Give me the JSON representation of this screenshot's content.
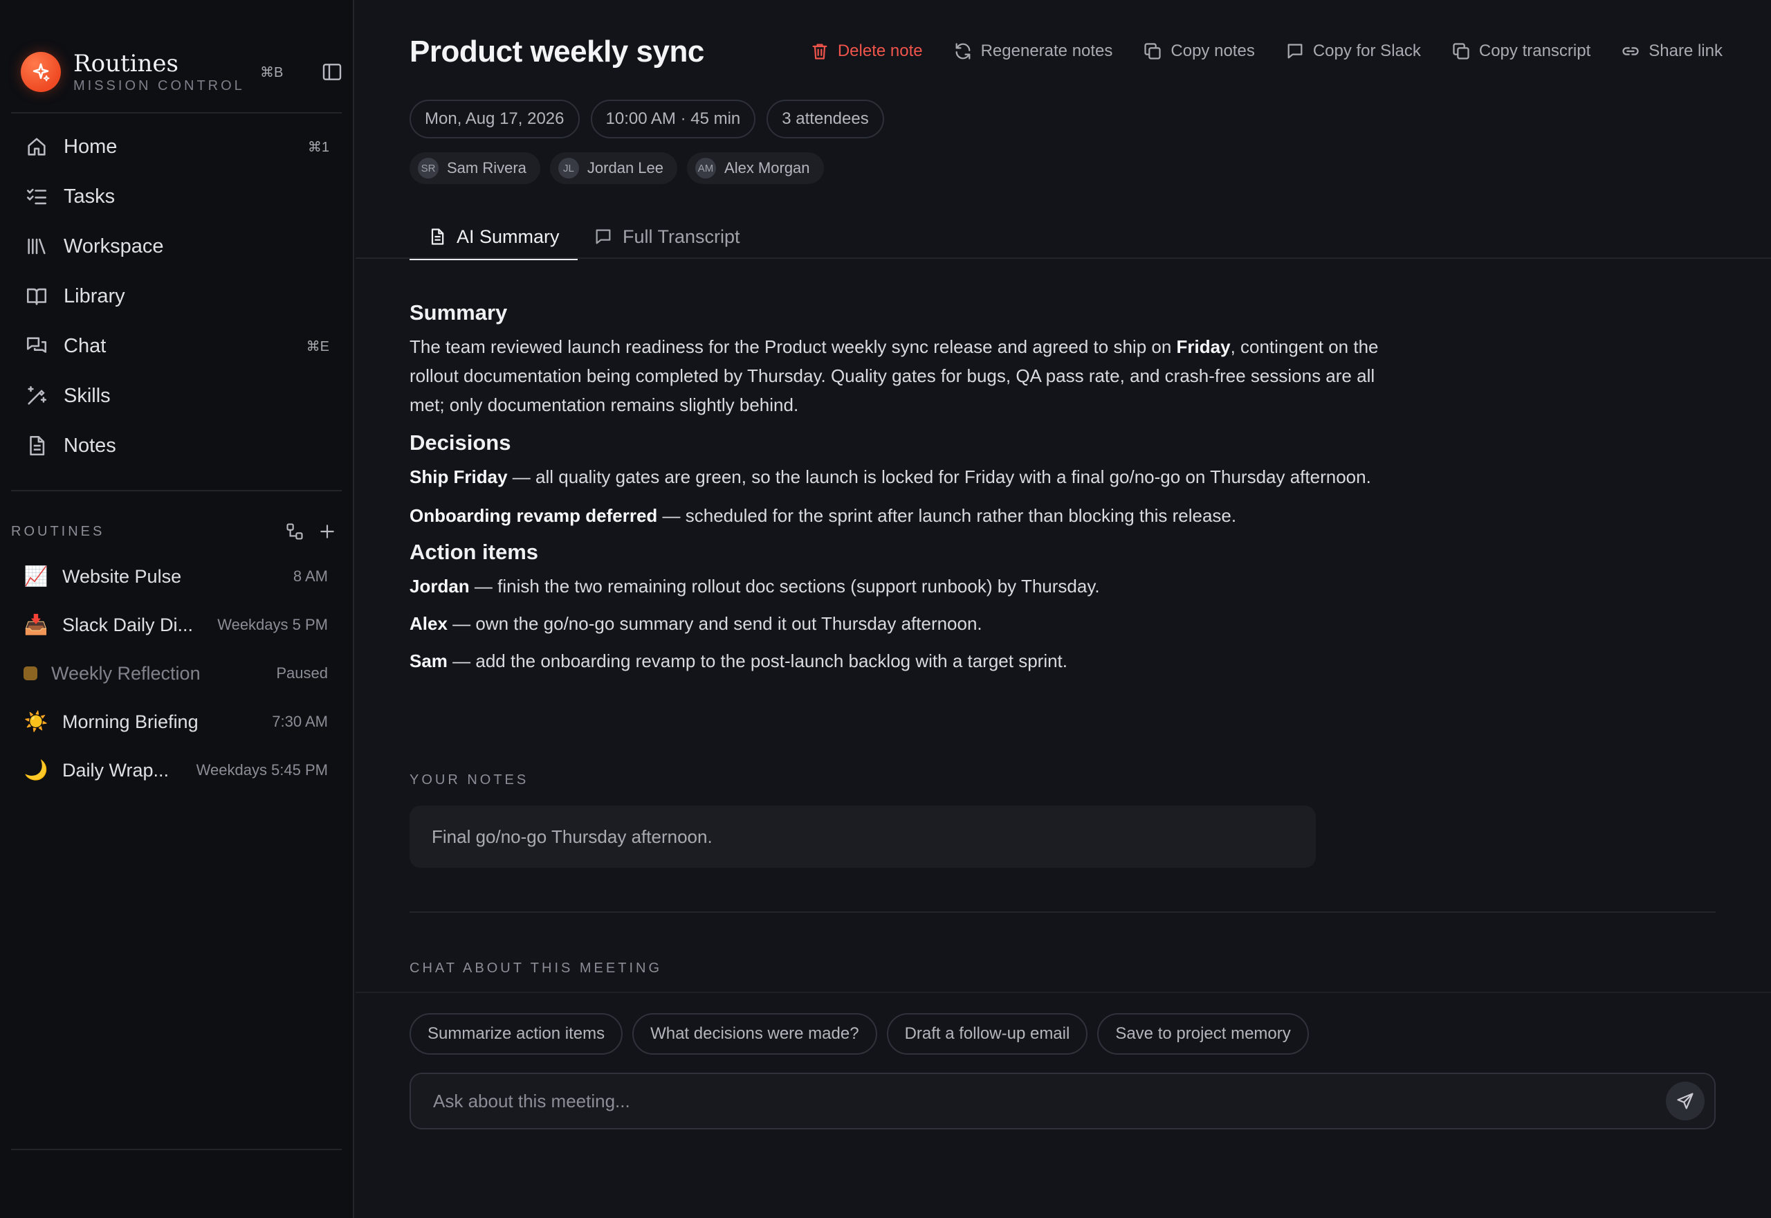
{
  "app": {
    "name": "Routines",
    "subtitle": "MISSION CONTROL",
    "toggle_shortcut": "⌘B"
  },
  "nav": [
    {
      "label": "Home",
      "icon": "home-icon",
      "shortcut": "⌘1"
    },
    {
      "label": "Tasks",
      "icon": "tasks-icon",
      "shortcut": ""
    },
    {
      "label": "Workspace",
      "icon": "workspace-icon",
      "shortcut": ""
    },
    {
      "label": "Library",
      "icon": "book-icon",
      "shortcut": ""
    },
    {
      "label": "Chat",
      "icon": "chat-icon",
      "shortcut": "⌘E"
    },
    {
      "label": "Skills",
      "icon": "wand-icon",
      "shortcut": ""
    },
    {
      "label": "Notes",
      "icon": "note-icon",
      "shortcut": ""
    }
  ],
  "routines": {
    "header": "ROUTINES",
    "items": [
      {
        "emoji": "📈",
        "name": "Website Pulse",
        "schedule": "8 AM",
        "paused": false
      },
      {
        "emoji": "📥",
        "name": "Slack Daily Di...",
        "schedule": "Weekdays 5 PM",
        "paused": false
      },
      {
        "emoji": "",
        "name": "Weekly Reflection",
        "schedule": "Paused",
        "paused": true
      },
      {
        "emoji": "☀️",
        "name": "Morning Briefing",
        "schedule": "7:30 AM",
        "paused": false
      },
      {
        "emoji": "🌙",
        "name": "Daily Wrap...",
        "schedule": "Weekdays 5:45 PM",
        "paused": false
      }
    ]
  },
  "meeting": {
    "title": "Product weekly sync",
    "date": "Mon, Aug 17, 2026",
    "time": "10:00 AM · 45 min",
    "attendee_count": "3 attendees",
    "attendees": [
      {
        "initials": "SR",
        "name": "Sam Rivera"
      },
      {
        "initials": "JL",
        "name": "Jordan Lee"
      },
      {
        "initials": "AM",
        "name": "Alex Morgan"
      }
    ]
  },
  "actions": {
    "delete": "Delete note",
    "regenerate": "Regenerate notes",
    "copy_notes": "Copy notes",
    "copy_slack": "Copy for Slack",
    "copy_transcript": "Copy transcript",
    "share": "Share link"
  },
  "tabs": {
    "summary": "AI Summary",
    "transcript": "Full Transcript"
  },
  "summary": {
    "heading": "Summary",
    "text_before": "The team reviewed launch readiness for the Product weekly sync release and agreed to ship on ",
    "text_bold": "Friday",
    "text_after": ", contingent on the rollout documentation being completed by Thursday. Quality gates for bugs, QA pass rate, and crash-free sessions are all met; only documentation remains slightly behind."
  },
  "decisions": {
    "heading": "Decisions",
    "items": [
      {
        "bold": "Ship Friday",
        "text": " — all quality gates are green, so the launch is locked for Friday with a final go/no-go on Thursday afternoon."
      },
      {
        "bold": "Onboarding revamp deferred",
        "text": " — scheduled for the sprint after launch rather than blocking this release."
      }
    ]
  },
  "action_items": {
    "heading": "Action items",
    "items": [
      {
        "bold": "Jordan",
        "text": " — finish the two remaining rollout doc sections (support runbook) by Thursday."
      },
      {
        "bold": "Alex",
        "text": " — own the go/no-go summary and send it out Thursday afternoon."
      },
      {
        "bold": "Sam",
        "text": " — add the onboarding revamp to the post-launch backlog with a target sprint."
      }
    ]
  },
  "notes": {
    "label": "YOUR NOTES",
    "text": "Final go/no-go Thursday afternoon."
  },
  "chat": {
    "label": "CHAT ABOUT THIS MEETING",
    "suggestions": [
      "Summarize action items",
      "What decisions were made?",
      "Draft a follow-up email",
      "Save to project memory"
    ],
    "placeholder": "Ask about this meeting..."
  },
  "colors": {
    "accent": "#ef4a23",
    "danger": "#f0544a",
    "background": "#121419",
    "sidebar": "#0e0f13"
  }
}
